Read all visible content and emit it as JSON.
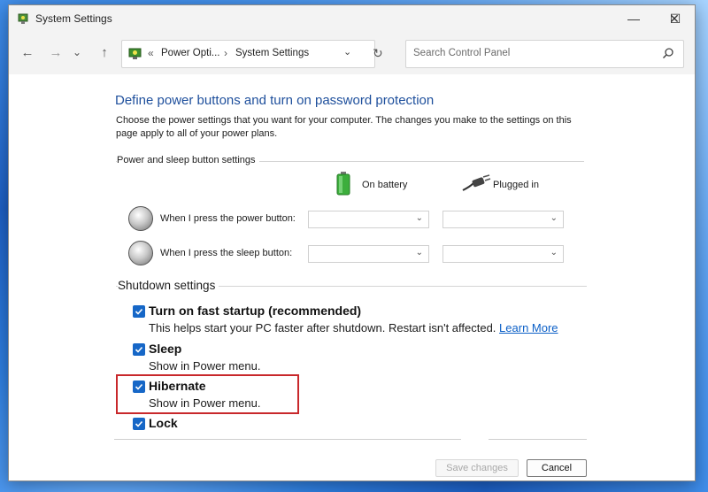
{
  "window": {
    "title": "System Settings"
  },
  "caption": {
    "minimize": "—",
    "maximize": "☐",
    "close": "✕"
  },
  "nav": {
    "back": "←",
    "forward": "→",
    "recent": "⌄",
    "up": "↑",
    "breadcrumb": {
      "prefix": "«",
      "crumb1": "Power Opti...",
      "sep": "›",
      "crumb2": "System Settings"
    },
    "dropdown": "⌄",
    "refresh": "↻"
  },
  "search": {
    "placeholder": "Search Control Panel"
  },
  "page": {
    "heading": "Define power buttons and turn on password protection",
    "description": "Choose the power settings that you want for your computer. The changes you make to the settings on this page apply to all of your power plans."
  },
  "power_group": {
    "label": "Power and sleep button settings",
    "col_battery": "On battery",
    "col_plugged": "Plugged in",
    "rows": [
      {
        "label": "When I press the power button:",
        "battery_value": "",
        "plugged_value": ""
      },
      {
        "label": "When I press the sleep button:",
        "battery_value": "",
        "plugged_value": ""
      }
    ]
  },
  "shutdown": {
    "label": "Shutdown settings",
    "items": [
      {
        "label": "Turn on fast startup (recommended)",
        "desc": "This helps start your PC faster after shutdown. Restart isn't affected.",
        "link": "Learn More",
        "checked": true
      },
      {
        "label": "Sleep",
        "desc": "Show in Power menu.",
        "checked": true
      },
      {
        "label": "Hibernate",
        "desc": "Show in Power menu.",
        "checked": true
      },
      {
        "label": "Lock",
        "checked": true
      }
    ]
  },
  "footer": {
    "save_label": "Save changes",
    "cancel_label": "Cancel"
  },
  "colors": {
    "accent": "#1667c7",
    "heading": "#1e4f9c",
    "link": "#0b5fc7",
    "highlight": "#c8282b"
  }
}
